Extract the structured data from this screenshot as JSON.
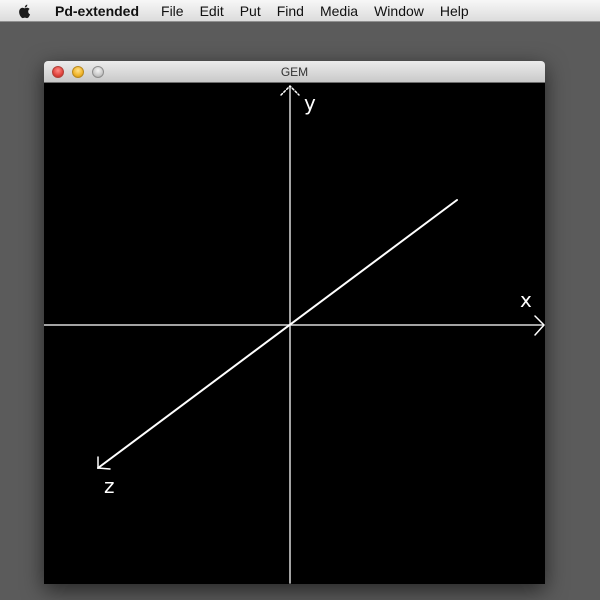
{
  "menubar": {
    "app_name": "Pd-extended",
    "items": [
      "File",
      "Edit",
      "Put",
      "Find",
      "Media",
      "Window",
      "Help"
    ]
  },
  "window": {
    "title": "GEM"
  },
  "axes": {
    "x_label": "x",
    "y_label": "y",
    "z_label": "z",
    "line_color": "#ffffff",
    "background_color": "#000000"
  }
}
